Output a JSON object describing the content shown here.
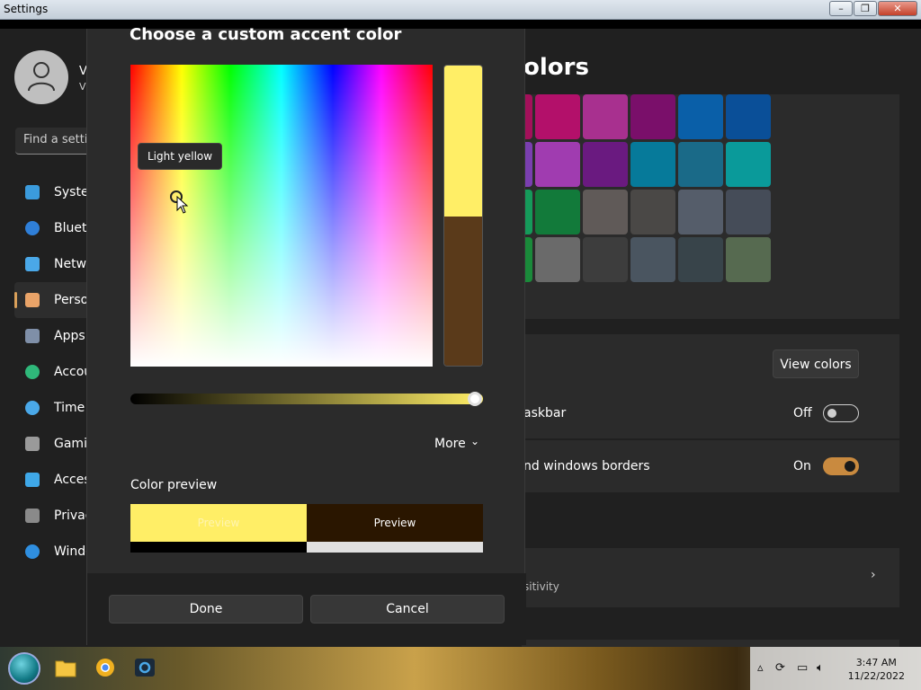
{
  "window": {
    "title": "Settings",
    "minimize": "–",
    "maximize": "❐",
    "close": "✕"
  },
  "sidebar": {
    "user_initial": "V",
    "user_sub": "V",
    "search_placeholder": "Find a setti",
    "items": [
      {
        "label": "Systen",
        "icon": "monitor-icon",
        "color": "#3b9bdc"
      },
      {
        "label": "Blueto",
        "icon": "bluetooth-icon",
        "color": "#2f7fd8"
      },
      {
        "label": "Netwo",
        "icon": "wifi-icon",
        "color": "#4aa8e8"
      },
      {
        "label": "Persor",
        "icon": "brush-icon",
        "color": "#e9a368",
        "active": true
      },
      {
        "label": "Apps",
        "icon": "apps-icon",
        "color": "#7f8fa8"
      },
      {
        "label": "Accou",
        "icon": "person-icon",
        "color": "#2fb87a"
      },
      {
        "label": "Time",
        "icon": "clock-icon",
        "color": "#4aa8e8"
      },
      {
        "label": "Gamin",
        "icon": "gamepad-icon",
        "color": "#9a9a9a"
      },
      {
        "label": "Acces",
        "icon": "accessibility-icon",
        "color": "#3fa8e8"
      },
      {
        "label": "Privac",
        "icon": "shield-icon",
        "color": "#8a8a8a"
      },
      {
        "label": "Windo",
        "icon": "update-icon",
        "color": "#2f8fe0"
      }
    ]
  },
  "main": {
    "page_title": "olors",
    "swatches": [
      [
        "#a3105a",
        "#b3106a",
        "#a8308f",
        "#7a0f6a",
        "#0a5fa8",
        "#0a4f98"
      ],
      [
        "#7a3fb0",
        "#a03cb0",
        "#6a1a80",
        "#067a9a",
        "#1a6a88",
        "#0a9a9a"
      ],
      [
        "#159a5a",
        "#127a3a",
        "#605a58",
        "#4a4846",
        "#555d6a",
        "#454c58"
      ],
      [
        "#1a8a3a",
        "#6a6a6a",
        "#3d3d3d",
        "#4a5560",
        "#38444a",
        "#566a50"
      ]
    ],
    "view_colors": "View colors",
    "taskbar_row": {
      "label": "askbar",
      "state": "Off"
    },
    "borders_row": {
      "label": "nd windows borders",
      "state": "On"
    },
    "lower_sub": "sitivity",
    "chevron": "›"
  },
  "dialog": {
    "title": "Choose a custom accent color",
    "tooltip": "Light yellow",
    "selected_color": "#ffee66",
    "previous_color": "#5a3a1a",
    "more_label": "More",
    "more_chevron": "⌄",
    "color_preview_label": "Color preview",
    "preview_light_text": "Preview",
    "preview_dark_text": "Preview",
    "preview_light_bg": "#ffee66",
    "preview_dark_bg": "#2a1600",
    "preview_bar_left": "#000000",
    "preview_bar_right": "#e0e0e0",
    "done": "Done",
    "cancel": "Cancel"
  },
  "taskbar": {
    "time": "3:47 AM",
    "date": "11/22/2022"
  }
}
